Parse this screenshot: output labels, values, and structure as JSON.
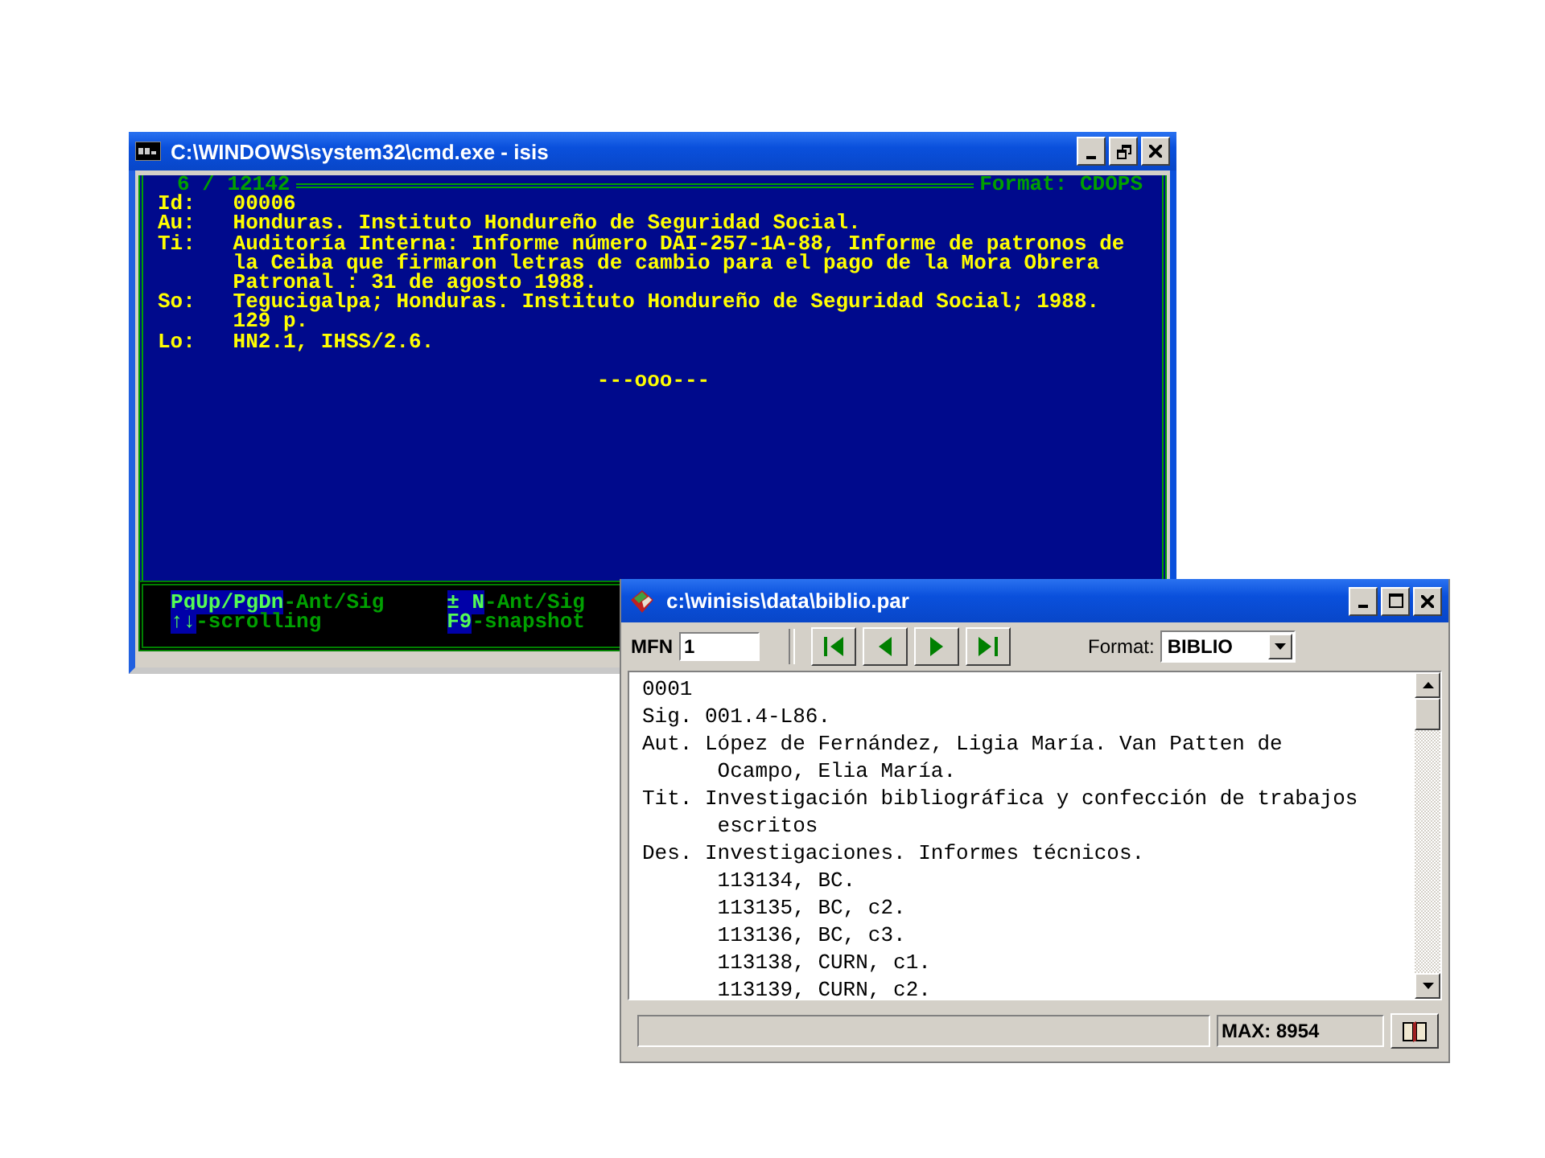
{
  "console_window": {
    "title": "C:\\WINDOWS\\system32\\cmd.exe - isis",
    "title_buttons": [
      {
        "kind": "minimize"
      },
      {
        "kind": "restore"
      },
      {
        "kind": "close"
      }
    ],
    "record_counter": "6 / 12142",
    "format_label": "Format: CDOPS",
    "fields": [
      {
        "tag": "Id:",
        "lines": [
          "00006"
        ]
      },
      {
        "tag": "Au:",
        "lines": [
          "Honduras. Instituto Hondureño de Seguridad Social."
        ]
      },
      {
        "tag": "Ti:",
        "lines": [
          "Auditoría Interna: Informe número DAI-257-1A-88, Informe de patronos de",
          "la Ceiba que firmaron letras de cambio para el pago de la Mora Obrera",
          "Patronal : 31 de agosto 1988."
        ]
      },
      {
        "tag": "So:",
        "lines": [
          "Tegucigalpa; Honduras. Instituto Hondureño de Seguridad Social; 1988.",
          "129 p."
        ]
      },
      {
        "tag": "Lo:",
        "lines": [
          "HN2.1, IHSS/2.6."
        ]
      }
    ],
    "end_marker": "---ooo---",
    "footer_keys": [
      {
        "key": "PgUp/PgDn",
        "action": "-Ant/Sig"
      },
      {
        "key": "↑↓",
        "action": "-scrolling"
      },
      {
        "key": "± N",
        "action": "-Ant/Sig"
      },
      {
        "key": "F9",
        "action": "-snapshot"
      }
    ]
  },
  "winisis_window": {
    "title": "c:\\winisis\\data\\biblio.par",
    "title_buttons": [
      {
        "kind": "minimize"
      },
      {
        "kind": "maximize"
      },
      {
        "kind": "close"
      }
    ],
    "mfn_label": "MFN",
    "mfn_value": "1",
    "nav_buttons": [
      {
        "kind": "first"
      },
      {
        "kind": "previous"
      },
      {
        "kind": "next"
      },
      {
        "kind": "last"
      }
    ],
    "format_label": "Format:",
    "format_value": "BIBLIO",
    "record": [
      {
        "lines": [
          "0001"
        ]
      },
      {
        "tag": "Sig.",
        "lines": [
          "001.4-L86."
        ]
      },
      {
        "tag": "Aut.",
        "lines": [
          "López de Fernández, Ligia María. Van Patten de",
          "Ocampo, Elia María."
        ]
      },
      {
        "tag": "Tit.",
        "lines": [
          "Investigación bibliográfica y confección de trabajos",
          "escritos"
        ]
      },
      {
        "tag": "Des.",
        "lines": [
          "Investigaciones. Informes técnicos.",
          "113134, BC.",
          "113135, BC, c2.",
          "113136, BC, c3.",
          "113138, CURN, c1.",
          "113139, CURN, c2."
        ]
      }
    ],
    "status": "MAX: 8954"
  }
}
